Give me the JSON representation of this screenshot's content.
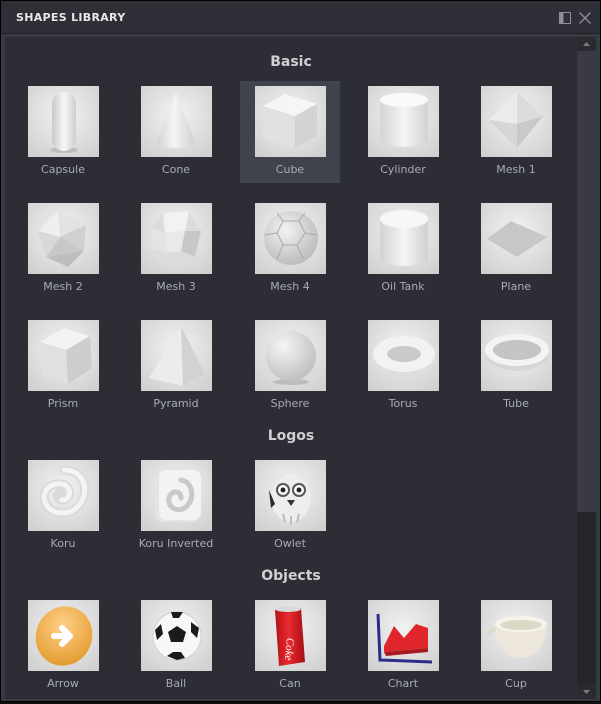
{
  "window": {
    "title": "SHAPES LIBRARY"
  },
  "sections": [
    {
      "title": "Basic",
      "items": [
        {
          "label": "Capsule",
          "icon": "capsule-icon"
        },
        {
          "label": "Cone",
          "icon": "cone-icon"
        },
        {
          "label": "Cube",
          "icon": "cube-icon",
          "selected": true
        },
        {
          "label": "Cylinder",
          "icon": "cylinder-icon"
        },
        {
          "label": "Mesh 1",
          "icon": "mesh-1-icon"
        },
        {
          "label": "Mesh 2",
          "icon": "mesh-2-icon"
        },
        {
          "label": "Mesh 3",
          "icon": "mesh-3-icon"
        },
        {
          "label": "Mesh 4",
          "icon": "mesh-4-icon"
        },
        {
          "label": "Oil Tank",
          "icon": "oil-tank-icon"
        },
        {
          "label": "Plane",
          "icon": "plane-icon"
        },
        {
          "label": "Prism",
          "icon": "prism-icon"
        },
        {
          "label": "Pyramid",
          "icon": "pyramid-icon"
        },
        {
          "label": "Sphere",
          "icon": "sphere-icon"
        },
        {
          "label": "Torus",
          "icon": "torus-icon"
        },
        {
          "label": "Tube",
          "icon": "tube-icon"
        }
      ]
    },
    {
      "title": "Logos",
      "items": [
        {
          "label": "Koru",
          "icon": "koru-icon"
        },
        {
          "label": "Koru Inverted",
          "icon": "koru-inverted-icon"
        },
        {
          "label": "Owlet",
          "icon": "owlet-icon"
        }
      ]
    },
    {
      "title": "Objects",
      "items": [
        {
          "label": "Arrow",
          "icon": "arrow-icon"
        },
        {
          "label": "Ball",
          "icon": "ball-icon"
        },
        {
          "label": "Can",
          "icon": "can-icon",
          "can_text": "Coke"
        },
        {
          "label": "Chart",
          "icon": "chart-icon"
        },
        {
          "label": "Cup",
          "icon": "cup-icon"
        }
      ]
    }
  ]
}
